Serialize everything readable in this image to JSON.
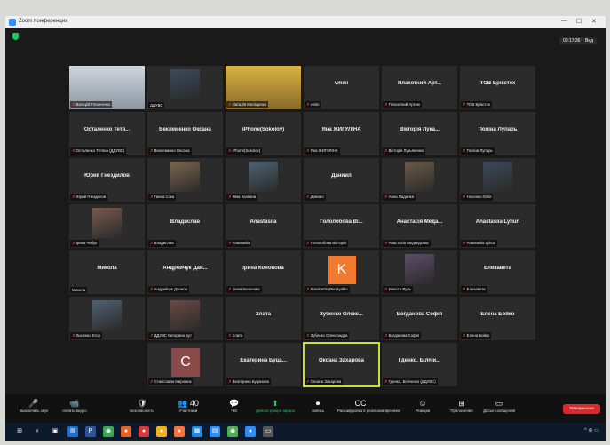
{
  "window": {
    "title": "Zoom Конференция",
    "minimize": "—",
    "maximize": "☐",
    "close": "✕"
  },
  "header": {
    "timer": "00:17:36",
    "view": "Вид"
  },
  "tiles": [
    {
      "name": "",
      "label": "Валерій Планченко",
      "video": true,
      "muted": true
    },
    {
      "name": "",
      "label": "ДДУВС",
      "photo": true,
      "muted": false
    },
    {
      "name": "",
      "label": "Наталія Меліщенко",
      "video": true,
      "muted": true
    },
    {
      "name": "vmiki",
      "label": "vmiki",
      "muted": true
    },
    {
      "name": "Плахотний Арт...",
      "label": "Плахотний Артем",
      "muted": true
    },
    {
      "name": "ТОВ Брікстех",
      "label": "ТОВ Брікстех",
      "muted": true
    },
    {
      "name": "Осталенко Тетя...",
      "label": "Осталенко Тетяна (ДДУВС)",
      "muted": true
    },
    {
      "name": "Веклеменко Оксана",
      "label": "Веклеменко Оксана",
      "muted": true
    },
    {
      "name": "iPhone(Sokolov)",
      "label": "iPhone(Sokolov)",
      "muted": true
    },
    {
      "name": "Яна ЖИГУЛІНА",
      "label": "Яна ЖИГУЛІНА",
      "muted": true
    },
    {
      "name": "Вікторія Лука...",
      "label": "Вікторія Лукьяненко",
      "muted": true
    },
    {
      "name": "Поліна Лупарь",
      "label": "Поліна Лупарь",
      "muted": true
    },
    {
      "name": "Юрий Гнездилов",
      "label": "Юрий Гнездилов",
      "muted": true
    },
    {
      "name": "",
      "label": "Ганна Сока",
      "photo": true,
      "muted": true
    },
    {
      "name": "",
      "label": "Ніна Калініна",
      "photo": true,
      "muted": true
    },
    {
      "name": "Даниил",
      "label": "Даниил",
      "muted": true
    },
    {
      "name": "",
      "label": "Анна Падалка",
      "photo": true,
      "muted": true
    },
    {
      "name": "",
      "label": "Носенко Юлія",
      "photo": true,
      "muted": true
    },
    {
      "name": "",
      "label": "Ірина Чибук",
      "photo": true,
      "muted": true
    },
    {
      "name": "Владислав",
      "label": "Владислав",
      "muted": true
    },
    {
      "name": "Anastasiia",
      "label": "Anastasiia",
      "muted": true
    },
    {
      "name": "Гололобова Ві...",
      "label": "Гололобова Вікторія",
      "muted": true
    },
    {
      "name": "Анастасія Меда...",
      "label": "Анастасія Медведська",
      "muted": true
    },
    {
      "name": "Anastasiia Lyhun",
      "label": "Anastasiia Lyhun",
      "muted": true
    },
    {
      "name": "Микола",
      "label": "Микола",
      "muted": false
    },
    {
      "name": "Андрейчук Дан...",
      "label": "Андрейчук Данило",
      "muted": true
    },
    {
      "name": "Ірина Кононова",
      "label": "Ірина Кононова",
      "muted": true
    },
    {
      "name": "",
      "label": "Konstantin Peretyatko",
      "letter": "K",
      "letter_color": "#f07a2e",
      "muted": true
    },
    {
      "name": "",
      "label": "Инесса Руль",
      "photo": true,
      "muted": true
    },
    {
      "name": "Елизавета",
      "label": "Елизавета",
      "muted": true
    },
    {
      "name": "",
      "label": "Лысенко Егор",
      "photo": true,
      "muted": true
    },
    {
      "name": "",
      "label": "ДДУВС Катерина Бут",
      "photo": true,
      "muted": true
    },
    {
      "name": "Злата",
      "label": "Злата",
      "muted": true
    },
    {
      "name": "Зубенко Олекс...",
      "label": "Зубенко Олександра",
      "muted": true
    },
    {
      "name": "Богданова Софія",
      "label": "Богданова Софія",
      "muted": true
    },
    {
      "name": "Елена Бойко",
      "label": "Елена Бойко",
      "muted": true
    },
    {
      "name": "",
      "label": "Станіслава Миронюк",
      "letter": "С",
      "letter_color": "#8a4a4a",
      "muted": true
    },
    {
      "name": "Екатерина Буца...",
      "label": "Екатерина Буцанова",
      "muted": true
    },
    {
      "name": "Оксана Захарова",
      "label": "Оксана Захарова",
      "muted": true,
      "speaking": true
    },
    {
      "name": "Гденко, Білічи...",
      "label": "Гденко, Біліченко (ДДУВС)",
      "muted": true
    }
  ],
  "toolbar": [
    {
      "label": "Выключить звук",
      "icon": "🎤"
    },
    {
      "label": "Начать видео",
      "icon": "📹"
    },
    {
      "label": "Безопасность",
      "icon": "🛡"
    },
    {
      "label": "Участники",
      "icon": "👥",
      "count": "40"
    },
    {
      "label": "Чат",
      "icon": "💬"
    },
    {
      "label": "Демонстрация экрана",
      "icon": "⬆",
      "accent": true
    },
    {
      "label": "Запись",
      "icon": "⏺"
    },
    {
      "label": "Расшифровка в реальном времени",
      "icon": "CC"
    },
    {
      "label": "Реакции",
      "icon": "☺"
    },
    {
      "label": "Приложения",
      "icon": "⊞"
    },
    {
      "label": "Досье сообщений",
      "icon": "▭"
    }
  ],
  "end_button": "Завершение",
  "colors": {
    "accent_green": "#22c55e",
    "end_red": "#e02828",
    "mic_muted": "#e52e2e",
    "speaker_outline": "#c8df3a"
  }
}
